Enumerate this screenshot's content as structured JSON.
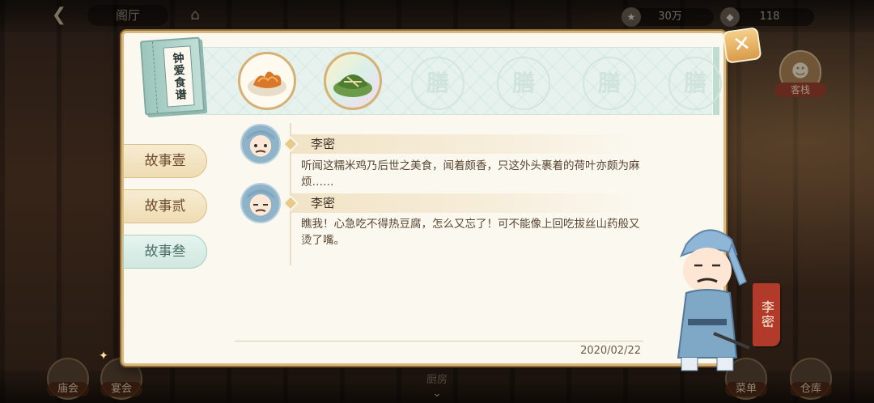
{
  "top_bar": {
    "back_icon": "back-arrow-icon",
    "scene_title": "阁厅",
    "home_icon": "building-icon",
    "currency_1": {
      "icon": "coin-icon",
      "value": "30万"
    },
    "currency_2": {
      "icon": "gem-icon",
      "value": "118"
    }
  },
  "side": {
    "guest_label": "客栈"
  },
  "bottom_bar": {
    "left_1": "庙会",
    "left_2": "宴会",
    "center": "厨房",
    "right_1": "菜单",
    "right_2": "仓库"
  },
  "dialog": {
    "book_title": "钟爱食谱",
    "close_icon": "close-icon",
    "dishes": [
      {
        "name": "fried-dish",
        "icon": "food-plate-icon"
      },
      {
        "name": "zongzi-dish",
        "icon": "zongzi-icon"
      }
    ],
    "slot_glyph": "膳",
    "tabs": [
      {
        "label": "故事壹",
        "active": false
      },
      {
        "label": "故事贰",
        "active": false
      },
      {
        "label": "故事叁",
        "active": true
      }
    ],
    "entries": [
      {
        "speaker": "李密",
        "text": "听闻这糯米鸡乃后世之美食，闻着颇香，只这外头裹着的荷叶亦颇为麻烦……"
      },
      {
        "speaker": "李密",
        "text": "瞧我！心急吃不得热豆腐，怎么又忘了！可不能像上回吃拔丝山药般又烫了嘴。"
      }
    ],
    "date": "2020/02/22",
    "character_name": "李密"
  },
  "colors": {
    "panel_bg": "#fbf8ef",
    "panel_border": "#d9b97c",
    "tab_active": "#cfe8e0",
    "name_banner": "#b23a2a"
  }
}
